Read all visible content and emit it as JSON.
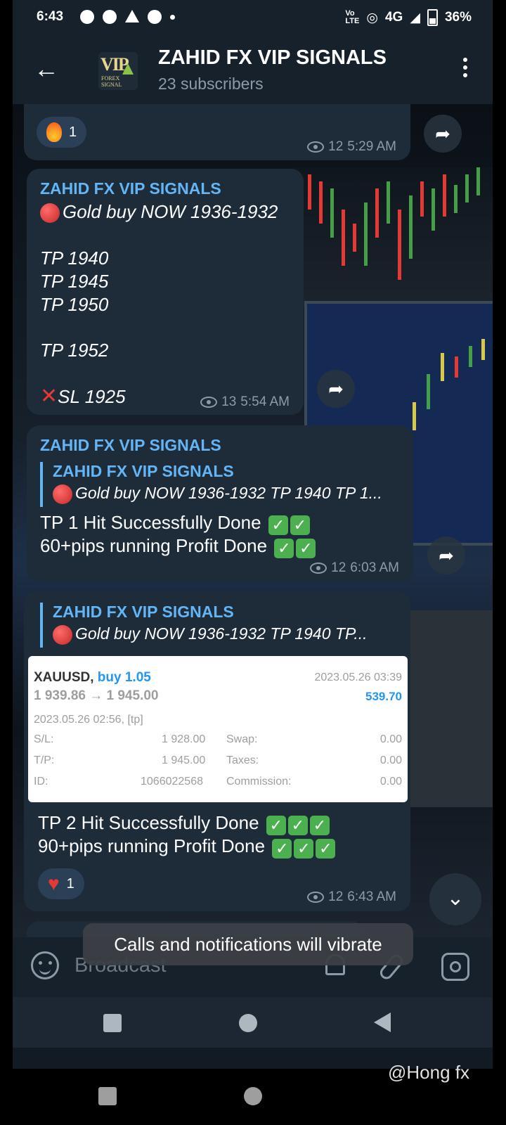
{
  "status_bar": {
    "time": "6:43",
    "network": "4G",
    "battery": "36%",
    "volte": "Vo LTE"
  },
  "channel": {
    "title": "ZAHID FX VIP SIGNALS",
    "subscribers": "23 subscribers",
    "avatar_text": "VIP",
    "avatar_sub": "FOREX SIGNAL"
  },
  "messages": {
    "m0": {
      "reaction_count": "1",
      "views": "12",
      "time": "5:29 AM"
    },
    "m1": {
      "sender": "ZAHID FX VIP SIGNALS",
      "line1": "Gold buy NOW 1936-1932",
      "tp1": "TP 1940",
      "tp2": "TP 1945",
      "tp3": "TP 1950",
      "tp4": "TP 1952",
      "sl": "SL 1925",
      "views": "13",
      "time": "5:54 AM"
    },
    "m2": {
      "sender": "ZAHID FX VIP SIGNALS",
      "quote_sender": "ZAHID FX VIP SIGNALS",
      "quote_text": "Gold buy NOW 1936-1932  TP 1940 TP 1...",
      "line1": "TP 1 Hit Successfully Done",
      "line2": "60+pips running Profit Done",
      "views": "12",
      "time": "6:03 AM"
    },
    "m3": {
      "quote_sender": "ZAHID FX VIP SIGNALS",
      "quote_text": "Gold buy NOW 1936-1932  TP 1940 TP...",
      "line1": "TP 2 Hit Successfully Done",
      "line2": "90+pips running Profit Done",
      "reaction_count": "1",
      "views": "12",
      "time": "6:43 AM"
    }
  },
  "trade": {
    "symbol": "XAUUSD,",
    "side": "buy 1.05",
    "close_time": "2023.05.26 03:39",
    "prices": "1 939.86 → 1 945.00",
    "profit": "539.70",
    "open_time": "2023.05.26 02:56, [tp]",
    "sl_label": "S/L:",
    "sl_value": "1 928.00",
    "tp_label": "T/P:",
    "tp_value": "1 945.00",
    "id_label": "ID:",
    "id_value": "1066022568",
    "swap_label": "Swap:",
    "swap_value": "0.00",
    "taxes_label": "Taxes:",
    "taxes_value": "0.00",
    "commission_label": "Commission:",
    "commission_value": "0.00"
  },
  "composer": {
    "placeholder": "Broadcast"
  },
  "toast": "Calls and notifications will vibrate",
  "watermark": "@Hong fx",
  "colors": {
    "bubble": "#1e2c3a",
    "accent": "#64b5f6",
    "header": "#17212b"
  }
}
